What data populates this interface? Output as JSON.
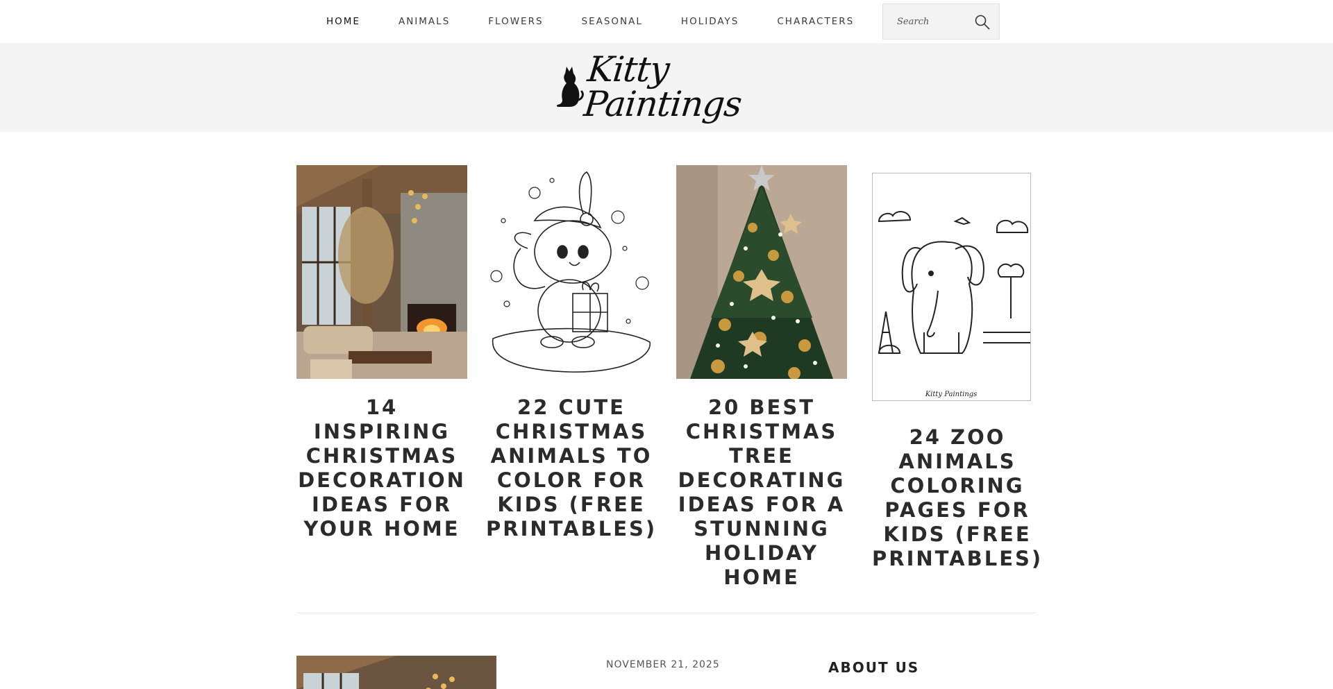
{
  "nav": {
    "items": [
      {
        "label": "HOME",
        "active": true
      },
      {
        "label": "ANIMALS"
      },
      {
        "label": "FLOWERS"
      },
      {
        "label": "SEASONAL"
      },
      {
        "label": "HOLIDAYS"
      },
      {
        "label": "CHARACTERS"
      }
    ],
    "search": {
      "placeholder": "Search",
      "value": "",
      "icon": "search-icon"
    }
  },
  "site": {
    "logo_text": "Kitty Paintings",
    "logo_icon": "cat-icon"
  },
  "featured": [
    {
      "title": "14 INSPIRING CHRISTMAS DECORATION IDEAS FOR YOUR HOME",
      "image": "cozy christmas living room"
    },
    {
      "title": "22 CUTE CHRISTMAS ANIMALS TO COLOR FOR KIDS (FREE PRINTABLES)",
      "image": "bunny with gift coloring page"
    },
    {
      "title": "20 BEST CHRISTMAS TREE DECORATING IDEAS FOR A STUNNING HOLIDAY HOME",
      "image": "decorated christmas tree"
    },
    {
      "title": "24 ZOO ANIMALS COLORING PAGES FOR KIDS (FREE PRINTABLES)",
      "image": "elephant coloring page",
      "watermark": "Kitty Paintings"
    }
  ],
  "latest": {
    "date": "NOVEMBER 21, 2025"
  },
  "sidebar": {
    "about_title": "ABOUT US"
  },
  "colors": {
    "header_band": "#f4f4f4",
    "title_text": "#2b2b2b",
    "search_bg": "#f3f3f3"
  }
}
